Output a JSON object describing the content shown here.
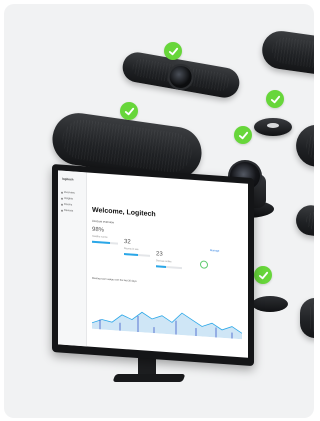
{
  "brand": {
    "accent_green": "#67d63a",
    "device_black": "#1c1d20",
    "chart_blue": "#2aa7e8"
  },
  "icons": [
    "check-icon",
    "video-bar-icon",
    "speaker-bar-icon",
    "ptz-camera-icon",
    "puck-icon",
    "monitor-icon"
  ],
  "screen": {
    "sidebar": {
      "title": "logitech",
      "items": [
        "Overview",
        "Insights",
        "Rooms",
        "Devices"
      ]
    },
    "welcome": "Welcome, Logitech",
    "account_overview_label": "Account overview",
    "manage_link": "Manage",
    "stats": [
      {
        "value": "98%",
        "caption": "Healthy rooms"
      },
      {
        "value": "32",
        "caption": "Rooms in use"
      },
      {
        "value": "23",
        "caption": "Devices online"
      }
    ],
    "usage_section_label": "Meeting room usage over the last 30 days"
  }
}
